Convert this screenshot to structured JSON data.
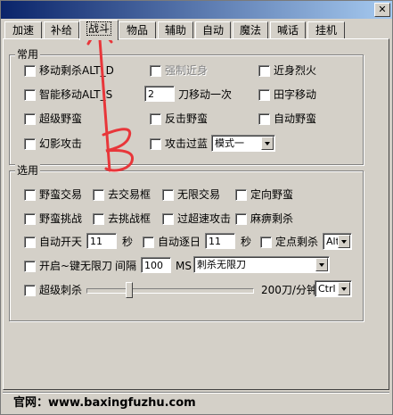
{
  "tabs": [
    {
      "label": "加速"
    },
    {
      "label": "补给"
    },
    {
      "label": "战斗",
      "active": true
    },
    {
      "label": "物品"
    },
    {
      "label": "辅助"
    },
    {
      "label": "自动"
    },
    {
      "label": "魔法"
    },
    {
      "label": "喊话"
    },
    {
      "label": "挂机"
    }
  ],
  "common": {
    "title": "常用",
    "move_kill": "移动剩杀ALT_D",
    "force_near": "强制近身",
    "near_fire": "近身烈火",
    "smart_move": "智能移动ALT_S",
    "blade_count": "2",
    "blade_move_label": "刀移动一次",
    "tian_move": "田字移动",
    "super_savage": "超级野蛮",
    "counter_savage": "反击野蛮",
    "auto_savage": "自动野蛮",
    "shadow_attack": "幻影攻击",
    "attack_blue": "攻击过蓝",
    "mode_value": "模式一"
  },
  "options": {
    "title": "选用",
    "savage_trade": "野蛮交易",
    "remove_trade_box": "去交易框",
    "no_trade": "无限交易",
    "directed_savage": "定向野蛮",
    "savage_challenge": "野蛮挑战",
    "remove_challenge_box": "去挑战框",
    "super_speed_attack": "过超速攻击",
    "paralyze_kill": "麻痹剩杀",
    "auto_open_sky": "自动开天",
    "open_sky_value": "11",
    "sec1": "秒",
    "auto_chase": "自动逐日",
    "chase_value": "11",
    "sec2": "秒",
    "fixed_kill": "定点剩杀",
    "fixed_kill_key": "Alt",
    "one_key_blade": "开启~键无限刀",
    "interval_label": "间隔",
    "interval_value": "100",
    "ms_label": "MS",
    "blade_mode": "刺杀无限刀",
    "super_kill": "超级刺杀",
    "rate_label": "200刀/分钟",
    "super_kill_key": "Ctrl"
  },
  "status": {
    "text": "官网：www.baxingfuzhu.com"
  },
  "colors": {
    "title_start": "#0a246a",
    "title_end": "#a6caf0",
    "annotation": "#e8363a"
  }
}
